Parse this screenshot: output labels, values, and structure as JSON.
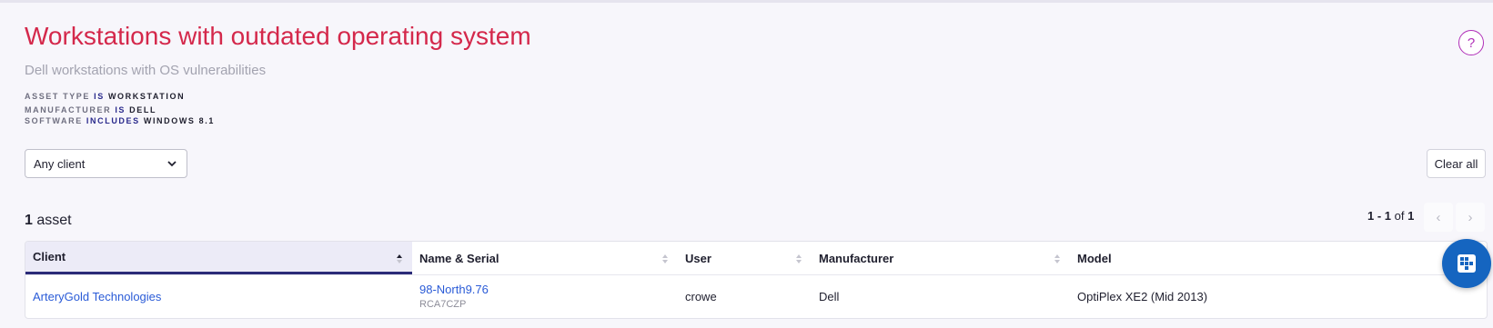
{
  "header": {
    "title": "Workstations with outdated operating system",
    "subtitle": "Dell workstations with OS vulnerabilities",
    "help_label": "?"
  },
  "filters": [
    {
      "field": "ASSET TYPE",
      "op": "IS",
      "value": "WORKSTATION"
    },
    {
      "field": "MANUFACTURER",
      "op": "IS",
      "value": "DELL"
    },
    {
      "field": "SOFTWARE",
      "op": "INCLUDES",
      "value": "WINDOWS 8.1"
    }
  ],
  "client_select": {
    "value": "Any client"
  },
  "clear_all_label": "Clear all",
  "results": {
    "count": "1",
    "noun": "asset"
  },
  "pagination": {
    "range": "1 - 1",
    "of": "of",
    "total": "1"
  },
  "table": {
    "columns": [
      "Client",
      "Name & Serial",
      "User",
      "Manufacturer",
      "Model"
    ],
    "rows": [
      {
        "client": "ArteryGold Technologies",
        "name": "98-North9.76",
        "serial": "RCA7CZP",
        "user": "crowe",
        "manufacturer": "Dell",
        "model": "OptiPlex XE2 (Mid 2013)"
      }
    ]
  },
  "colors": {
    "title": "#d4284b",
    "accent": "#2b2b78",
    "link": "#2a5bd7",
    "chat_button": "#1565c0",
    "help": "#b02fb8"
  },
  "icons": {
    "help": "question-icon",
    "dropdown": "chevron-down-icon",
    "sort": "sort-icon",
    "prev": "chevron-left-icon",
    "next": "chevron-right-icon",
    "chat": "chat-widget-icon"
  }
}
